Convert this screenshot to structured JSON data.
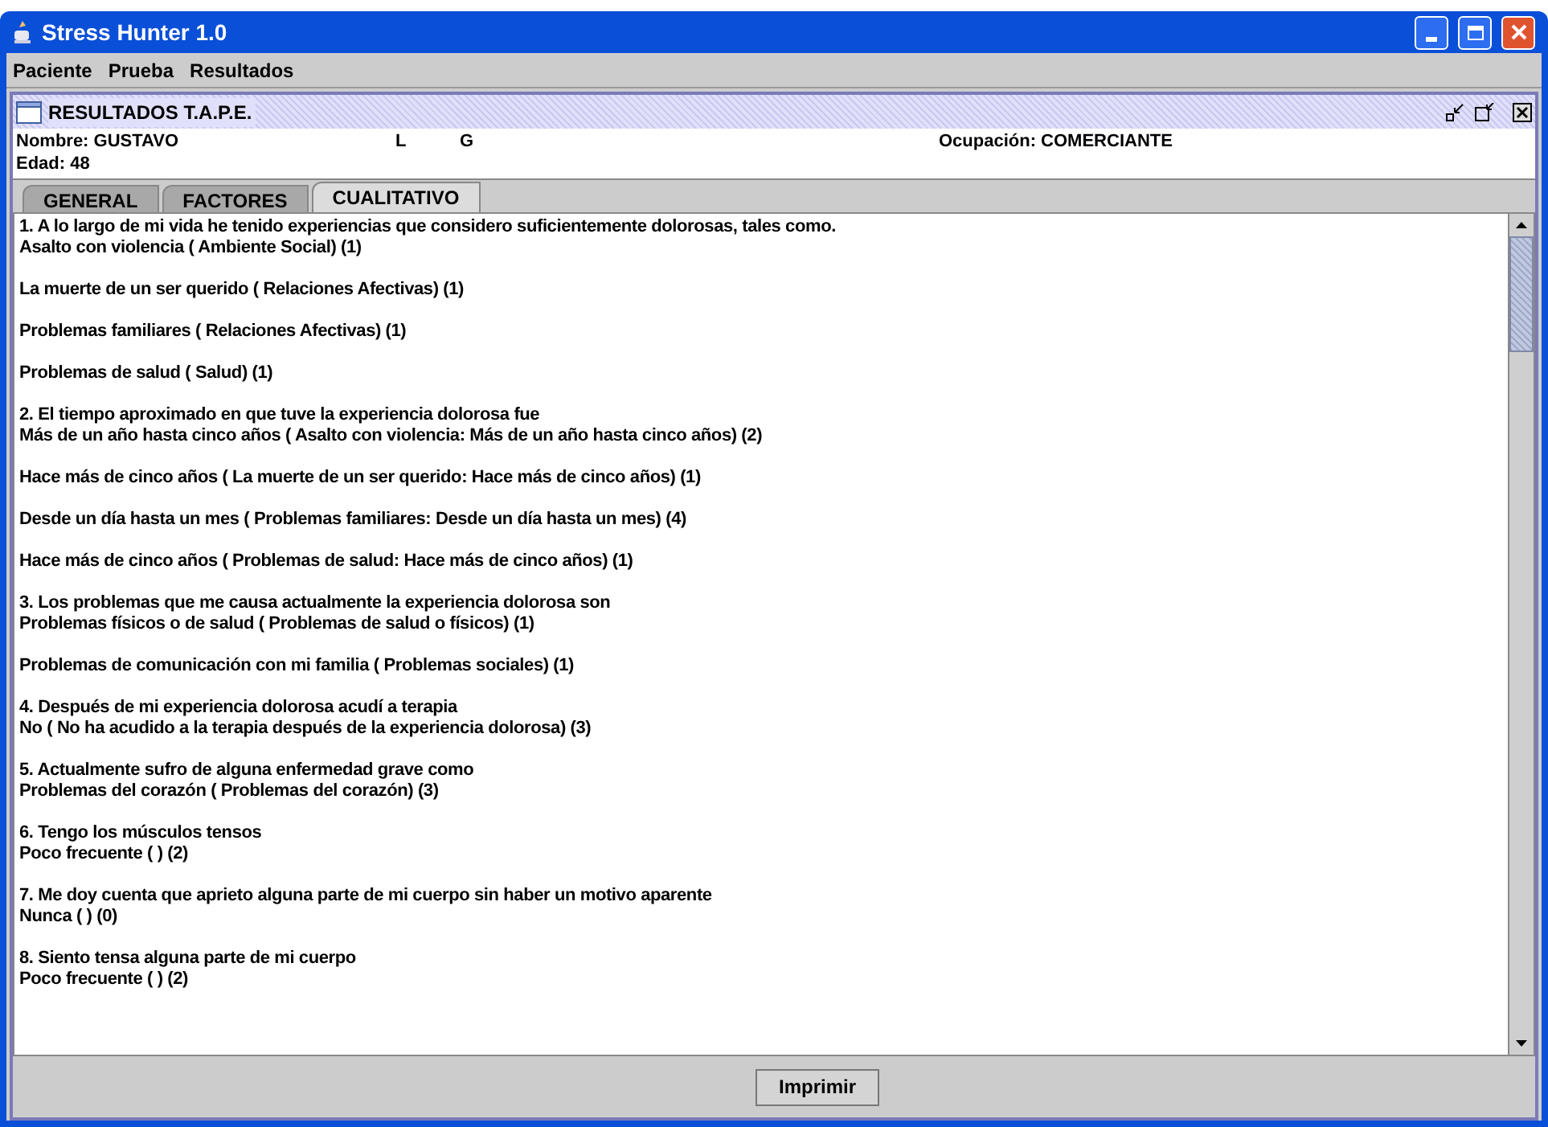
{
  "window": {
    "title": "Stress Hunter 1.0"
  },
  "menu": [
    {
      "label": "Paciente"
    },
    {
      "label": "Prueba"
    },
    {
      "label": "Resultados"
    }
  ],
  "internal_frame": {
    "title": "RESULTADOS T.A.P.E."
  },
  "patient": {
    "name": "Nombre: GUSTAVO",
    "surname_1": "L",
    "surname_2": "G",
    "occupation": "Ocupación: COMERCIANTE",
    "age": "Edad: 48"
  },
  "tabs": [
    {
      "label": "GENERAL",
      "selected": false
    },
    {
      "label": "FACTORES",
      "selected": false
    },
    {
      "label": "CUALITATIVO",
      "selected": true
    }
  ],
  "content": [
    {
      "lines": [
        "1. A lo largo de mi vida he tenido experiencias que considero suficientemente dolorosas, tales como.",
        "Asalto con violencia ( Ambiente Social) (1)"
      ]
    },
    {
      "lines": [
        "La muerte de un ser querido ( Relaciones Afectivas) (1)"
      ]
    },
    {
      "lines": [
        "Problemas familiares ( Relaciones Afectivas) (1)"
      ]
    },
    {
      "lines": [
        "Problemas de salud ( Salud) (1)"
      ]
    },
    {
      "lines": [
        "2. El tiempo aproximado en que tuve la experiencia dolorosa fue",
        "Más de un año hasta cinco años ( Asalto con violencia: Más de un año hasta cinco años) (2)"
      ]
    },
    {
      "lines": [
        "Hace más de cinco años ( La muerte de un ser querido: Hace más de cinco años) (1)"
      ]
    },
    {
      "lines": [
        "Desde un día hasta un mes ( Problemas familiares: Desde un día hasta un mes) (4)"
      ]
    },
    {
      "lines": [
        "Hace más de cinco años ( Problemas de salud: Hace más de cinco años) (1)"
      ]
    },
    {
      "lines": [
        "3. Los problemas que me causa actualmente la experiencia dolorosa son",
        "Problemas físicos o de salud ( Problemas de salud o físicos) (1)"
      ]
    },
    {
      "lines": [
        "Problemas de comunicación con mi familia ( Problemas sociales) (1)"
      ]
    },
    {
      "lines": [
        "4. Después de mi experiencia dolorosa acudí a terapia",
        "No ( No ha acudido a la terapia después de la experiencia dolorosa) (3)"
      ]
    },
    {
      "lines": [
        "5. Actualmente sufro de alguna enfermedad grave como",
        "Problemas del corazón ( Problemas del corazón) (3)"
      ]
    },
    {
      "lines": [
        "6. Tengo los músculos tensos",
        "Poco frecuente ( ) (2)"
      ]
    },
    {
      "lines": [
        "7. Me doy cuenta que aprieto alguna parte de mi cuerpo sin haber un motivo aparente",
        "Nunca ( ) (0)"
      ]
    },
    {
      "lines": [
        "8. Siento tensa alguna parte de mi cuerpo",
        "Poco frecuente ( ) (2)"
      ]
    }
  ],
  "print_button": "Imprimir"
}
